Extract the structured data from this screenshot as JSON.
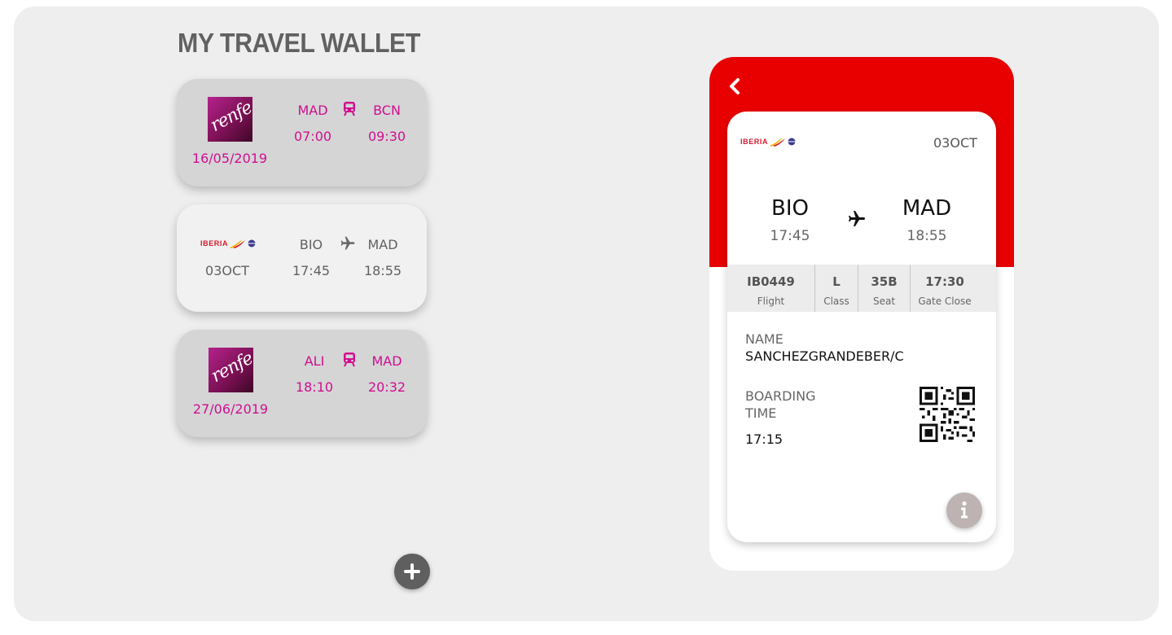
{
  "title": "MY TRAVEL WALLET",
  "tickets": [
    {
      "type": "train",
      "brand": "renfe",
      "date": "16/05/2019",
      "from": "MAD",
      "to": "BCN",
      "dep": "07:00",
      "arr": "09:30"
    },
    {
      "type": "flight",
      "brand": "IBERIA",
      "date": "03OCT",
      "from": "BIO",
      "to": "MAD",
      "dep": "17:45",
      "arr": "18:55"
    },
    {
      "type": "train",
      "brand": "renfe",
      "date": "27/06/2019",
      "from": "ALI",
      "to": "MAD",
      "dep": "18:10",
      "arr": "20:32"
    }
  ],
  "icons": {
    "add": "plus-icon",
    "back": "chevron-left-icon",
    "info": "info-icon",
    "train": "train-icon",
    "plane": "airplane-icon",
    "qr": "qr-code-icon"
  },
  "colors": {
    "train_text": "#cf0f8f",
    "iberia_red": "#e80000",
    "panel": "#eeeeee",
    "title": "#616161",
    "add_button": "#5f5f5f",
    "info_button": "#bdb3b3"
  },
  "boarding_pass": {
    "airline": "IBERIA",
    "date": "03OCT",
    "from": "BIO",
    "to": "MAD",
    "dep": "17:45",
    "arr": "18:55",
    "flight": {
      "value": "IB0449",
      "label": "Flight"
    },
    "class": {
      "value": "L",
      "label": "Class"
    },
    "seat": {
      "value": "35B",
      "label": "Seat"
    },
    "gate_close": {
      "value": "17:30",
      "label": "Gate Close"
    },
    "name_label": "NAME",
    "name": "SANCHEZGRANDEBER/C",
    "boarding_label_1": "BOARDING",
    "boarding_label_2": "TIME",
    "boarding_time": "17:15"
  }
}
